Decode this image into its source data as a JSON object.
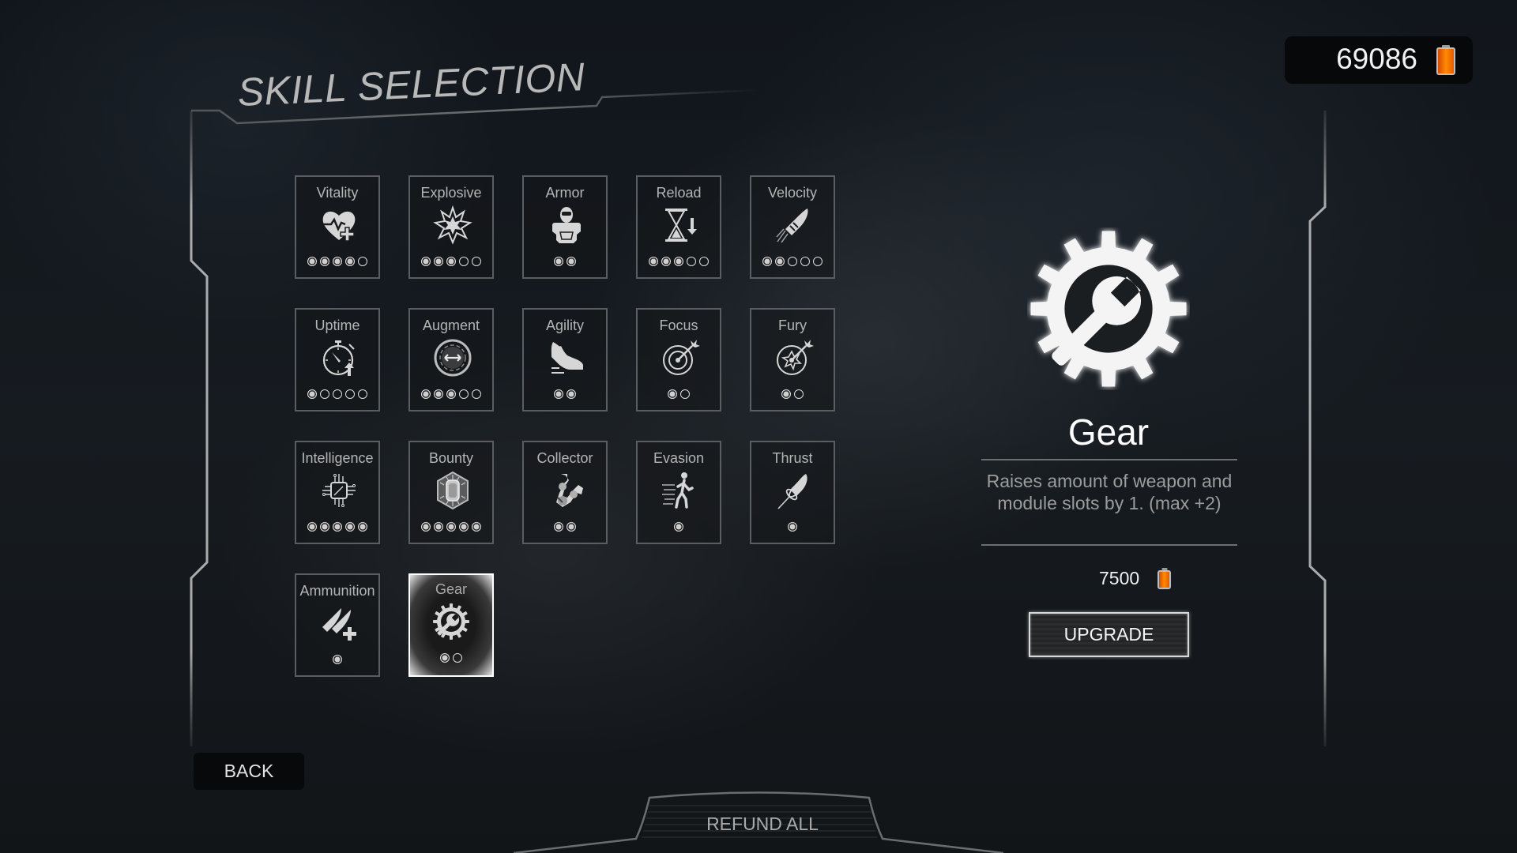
{
  "header": {
    "title": "SKILL SELECTION",
    "currency": {
      "amount": "69086",
      "icon": "battery-icon",
      "accent": "#ff7a00"
    }
  },
  "skills": [
    {
      "id": "vitality",
      "label": "Vitality",
      "icon": "heart-plus-icon",
      "level": 4,
      "max": 5
    },
    {
      "id": "explosive",
      "label": "Explosive",
      "icon": "explosion-icon",
      "level": 3,
      "max": 5
    },
    {
      "id": "armor",
      "label": "Armor",
      "icon": "armor-icon",
      "level": 2,
      "max": 2
    },
    {
      "id": "reload",
      "label": "Reload",
      "icon": "hourglass-down-icon",
      "level": 3,
      "max": 5
    },
    {
      "id": "velocity",
      "label": "Velocity",
      "icon": "bullet-speed-icon",
      "level": 2,
      "max": 5
    },
    {
      "id": "uptime",
      "label": "Uptime",
      "icon": "stopwatch-up-icon",
      "level": 1,
      "max": 5
    },
    {
      "id": "augment",
      "label": "Augment",
      "icon": "augment-ring-icon",
      "level": 3,
      "max": 5
    },
    {
      "id": "agility",
      "label": "Agility",
      "icon": "shoe-icon",
      "level": 2,
      "max": 2
    },
    {
      "id": "focus",
      "label": "Focus",
      "icon": "target-dart-icon",
      "level": 1,
      "max": 2
    },
    {
      "id": "fury",
      "label": "Fury",
      "icon": "target-burst-icon",
      "level": 1,
      "max": 2
    },
    {
      "id": "intelligence",
      "label": "Intelligence",
      "icon": "chip-icon",
      "level": 5,
      "max": 5
    },
    {
      "id": "bounty",
      "label": "Bounty",
      "icon": "hex-capsule-icon",
      "level": 5,
      "max": 5
    },
    {
      "id": "collector",
      "label": "Collector",
      "icon": "robot-arm-icon",
      "level": 2,
      "max": 2
    },
    {
      "id": "evasion",
      "label": "Evasion",
      "icon": "running-man-icon",
      "level": 1,
      "max": 1
    },
    {
      "id": "thrust",
      "label": "Thrust",
      "icon": "rocket-icon",
      "level": 1,
      "max": 1
    },
    {
      "id": "ammunition",
      "label": "Ammunition",
      "icon": "bullets-plus-icon",
      "level": 1,
      "max": 1
    },
    {
      "id": "gear",
      "label": "Gear",
      "icon": "gear-wrench-icon",
      "level": 1,
      "max": 2,
      "selected": true
    }
  ],
  "detail": {
    "title": "Gear",
    "icon": "gear-wrench-icon",
    "description": "Raises amount of weapon and module slots by 1. (max +2)",
    "cost": "7500",
    "upgrade_label": "UPGRADE"
  },
  "footer": {
    "back_label": "BACK",
    "refund_label": "REFUND ALL"
  }
}
